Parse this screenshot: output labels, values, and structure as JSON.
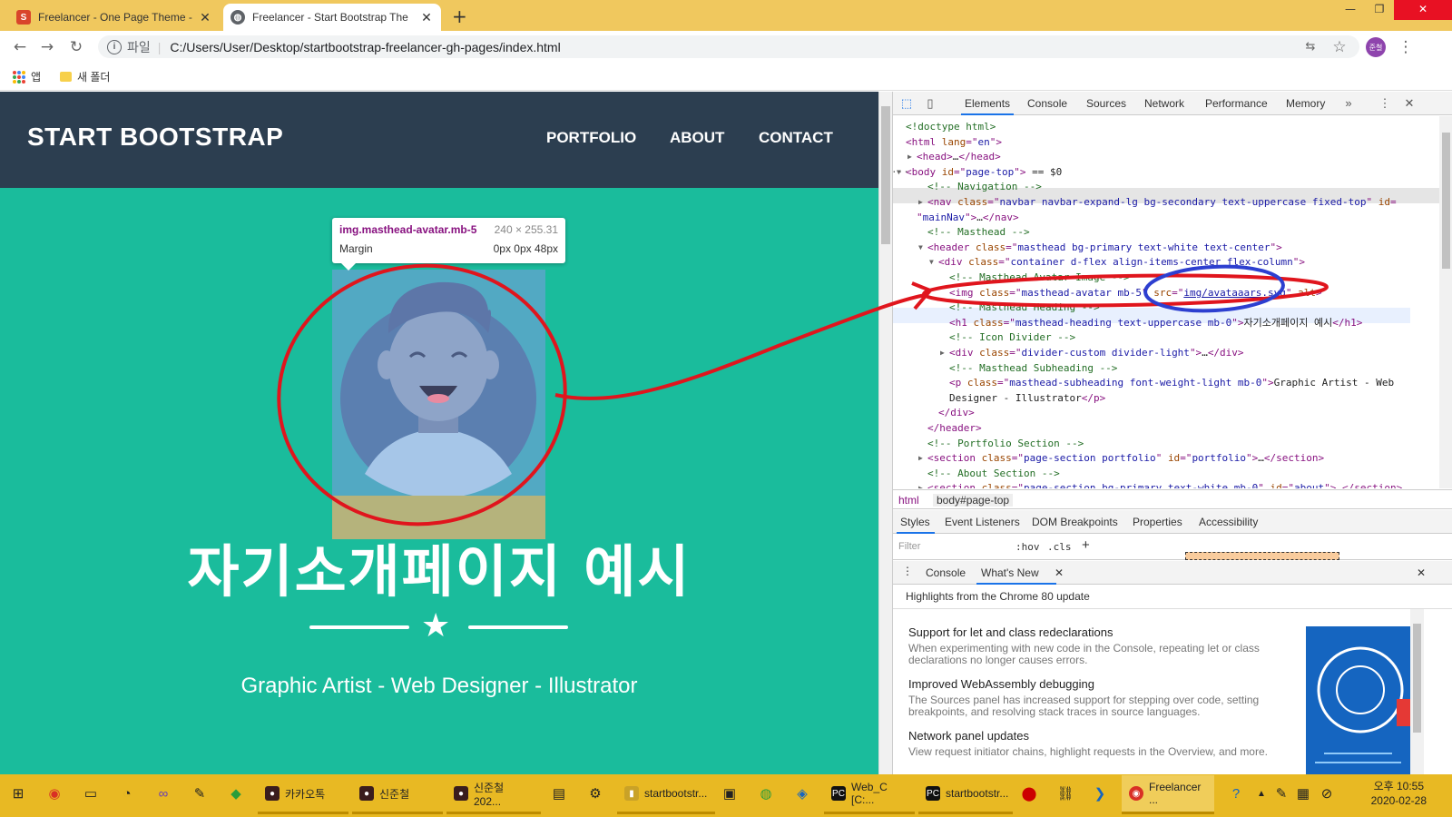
{
  "browser": {
    "tabs": [
      {
        "title": "Freelancer - One Page Theme -",
        "icon": "s-logo-icon"
      },
      {
        "title": "Freelancer - Start Bootstrap The",
        "icon": "globe-icon"
      }
    ],
    "address_label": "파일",
    "url": "C:/Users/User/Desktop/startbootstrap-freelancer-gh-pages/index.html",
    "profile_initials": "준철",
    "bookmarks": {
      "apps_label": "앱",
      "folder_label": "새 폴더"
    }
  },
  "page": {
    "brand": "START BOOTSTRAP",
    "nav": [
      "PORTFOLIO",
      "ABOUT",
      "CONTACT"
    ],
    "heading": "자기소개페이지 예시",
    "subheading": "Graphic Artist - Web Designer - Illustrator",
    "tooltip": {
      "selector": "img.masthead-avatar.mb-5",
      "size": "240 × 255.31",
      "margin_label": "Margin",
      "margin_value": "0px 0px 48px"
    }
  },
  "devtools": {
    "tabs": [
      "Elements",
      "Console",
      "Sources",
      "Network",
      "Performance",
      "Memory"
    ],
    "dom": [
      {
        "indent": 0,
        "parts": [
          [
            "cm",
            "<!doctype html>"
          ]
        ]
      },
      {
        "indent": 0,
        "parts": [
          [
            "tg",
            "<html "
          ],
          [
            "at",
            "lang"
          ],
          [
            "tg",
            "=\""
          ],
          [
            "av",
            "en"
          ],
          [
            "tg",
            "\">"
          ]
        ]
      },
      {
        "indent": 1,
        "arrow": "▶",
        "parts": [
          [
            "tg",
            "<head>"
          ],
          [
            "tx",
            "…"
          ],
          [
            "tg",
            "</head>"
          ]
        ]
      },
      {
        "indent": 0,
        "arrow": "▼",
        "prefix": "···",
        "parts": [
          [
            "tg",
            "<body "
          ],
          [
            "at",
            "id"
          ],
          [
            "tg",
            "=\""
          ],
          [
            "av",
            "page-top"
          ],
          [
            "tg",
            "\">"
          ],
          [
            "tx",
            " == $0"
          ]
        ]
      },
      {
        "indent": 2,
        "parts": [
          [
            "cm",
            "<!-- Navigation -->"
          ]
        ]
      },
      {
        "indent": 2,
        "arrow": "▶",
        "parts": [
          [
            "tg",
            "<nav "
          ],
          [
            "at",
            "class"
          ],
          [
            "tg",
            "=\""
          ],
          [
            "av",
            "navbar navbar-expand-lg bg-secondary text-uppercase fixed-top"
          ],
          [
            "tg",
            "\" "
          ],
          [
            "at",
            "id"
          ],
          [
            "tg",
            "="
          ]
        ]
      },
      {
        "indent": 1,
        "parts": [
          [
            "tg",
            "\""
          ],
          [
            "av",
            "mainNav"
          ],
          [
            "tg",
            "\">"
          ],
          [
            "tx",
            "…"
          ],
          [
            "tg",
            "</nav>"
          ]
        ]
      },
      {
        "indent": 2,
        "parts": [
          [
            "cm",
            "<!-- Masthead -->"
          ]
        ]
      },
      {
        "indent": 2,
        "arrow": "▼",
        "parts": [
          [
            "tg",
            "<header "
          ],
          [
            "at",
            "class"
          ],
          [
            "tg",
            "=\""
          ],
          [
            "av",
            "masthead bg-primary text-white text-center"
          ],
          [
            "tg",
            "\">"
          ]
        ]
      },
      {
        "indent": 3,
        "arrow": "▼",
        "parts": [
          [
            "tg",
            "<div "
          ],
          [
            "at",
            "class"
          ],
          [
            "tg",
            "=\""
          ],
          [
            "av",
            "container d-flex align-items-center flex-column"
          ],
          [
            "tg",
            "\">"
          ]
        ]
      },
      {
        "indent": 4,
        "parts": [
          [
            "cm",
            "<!-- Masthead Avatar Image -->"
          ]
        ]
      },
      {
        "indent": 4,
        "parts": [
          [
            "tg",
            "<img "
          ],
          [
            "at",
            "class"
          ],
          [
            "tg",
            "=\""
          ],
          [
            "av",
            "masthead-avatar mb-5"
          ],
          [
            "tg",
            "\" "
          ],
          [
            "at",
            "src"
          ],
          [
            "tg",
            "=\""
          ],
          [
            "lk",
            "img/avataaars.svg"
          ],
          [
            "tg",
            "\" "
          ],
          [
            "at",
            "alt"
          ],
          [
            "tg",
            ">"
          ]
        ]
      },
      {
        "indent": 4,
        "parts": [
          [
            "cm",
            "<!-- Masthead Heading -->"
          ]
        ]
      },
      {
        "indent": 4,
        "parts": [
          [
            "tg",
            "<h1 "
          ],
          [
            "at",
            "class"
          ],
          [
            "tg",
            "=\""
          ],
          [
            "av",
            "masthead-heading text-uppercase mb-0"
          ],
          [
            "tg",
            "\">"
          ],
          [
            "tx",
            "자기소개페이지 예시"
          ],
          [
            "tg",
            "</h1>"
          ]
        ]
      },
      {
        "indent": 4,
        "parts": [
          [
            "cm",
            "<!-- Icon Divider -->"
          ]
        ]
      },
      {
        "indent": 4,
        "arrow": "▶",
        "parts": [
          [
            "tg",
            "<div "
          ],
          [
            "at",
            "class"
          ],
          [
            "tg",
            "=\""
          ],
          [
            "av",
            "divider-custom divider-light"
          ],
          [
            "tg",
            "\">"
          ],
          [
            "tx",
            "…"
          ],
          [
            "tg",
            "</div>"
          ]
        ]
      },
      {
        "indent": 4,
        "parts": [
          [
            "cm",
            "<!-- Masthead Subheading -->"
          ]
        ]
      },
      {
        "indent": 4,
        "parts": [
          [
            "tg",
            "<p "
          ],
          [
            "at",
            "class"
          ],
          [
            "tg",
            "=\""
          ],
          [
            "av",
            "masthead-subheading font-weight-light mb-0"
          ],
          [
            "tg",
            "\">"
          ],
          [
            "tx",
            "Graphic Artist - Web"
          ]
        ]
      },
      {
        "indent": 4,
        "parts": [
          [
            "tx",
            "Designer - Illustrator"
          ],
          [
            "tg",
            "</p>"
          ]
        ]
      },
      {
        "indent": 3,
        "parts": [
          [
            "tg",
            "</div>"
          ]
        ]
      },
      {
        "indent": 2,
        "parts": [
          [
            "tg",
            "</header>"
          ]
        ]
      },
      {
        "indent": 2,
        "parts": [
          [
            "cm",
            "<!-- Portfolio Section -->"
          ]
        ]
      },
      {
        "indent": 2,
        "arrow": "▶",
        "parts": [
          [
            "tg",
            "<section "
          ],
          [
            "at",
            "class"
          ],
          [
            "tg",
            "=\""
          ],
          [
            "av",
            "page-section portfolio"
          ],
          [
            "tg",
            "\" "
          ],
          [
            "at",
            "id"
          ],
          [
            "tg",
            "=\""
          ],
          [
            "av",
            "portfolio"
          ],
          [
            "tg",
            "\">"
          ],
          [
            "tx",
            "…"
          ],
          [
            "tg",
            "</section>"
          ]
        ]
      },
      {
        "indent": 2,
        "parts": [
          [
            "cm",
            "<!-- About Section -->"
          ]
        ]
      },
      {
        "indent": 2,
        "arrow": "▶",
        "parts": [
          [
            "tg",
            "<section "
          ],
          [
            "at",
            "class"
          ],
          [
            "tg",
            "=\""
          ],
          [
            "av",
            "page-section bg-primary text-white mb-0"
          ],
          [
            "tg",
            "\" "
          ],
          [
            "at",
            "id"
          ],
          [
            "tg",
            "=\""
          ],
          [
            "av",
            "about"
          ],
          [
            "tg",
            "\">"
          ],
          [
            "tx",
            "…"
          ],
          [
            "tg",
            "</section>"
          ]
        ]
      }
    ],
    "breadcrumbs": [
      "html",
      "body#page-top"
    ],
    "style_tabs": [
      "Styles",
      "Event Listeners",
      "DOM Breakpoints",
      "Properties",
      "Accessibility"
    ],
    "filter_placeholder": "Filter",
    "hov": ":hov",
    "cls": ".cls",
    "drawer_tabs": [
      "Console",
      "What's New"
    ],
    "whatsnew_header": "Highlights from the Chrome 80 update",
    "whatsnew": [
      {
        "title": "Support for let and class redeclarations",
        "desc": "When experimenting with new code in the Console, repeating let or class declarations no longer causes errors."
      },
      {
        "title": "Improved WebAssembly debugging",
        "desc": "The Sources panel has increased support for stepping over code, setting breakpoints, and resolving stack traces in source languages."
      },
      {
        "title": "Network panel updates",
        "desc": "View request initiator chains, highlight requests in the Overview, and more."
      }
    ]
  },
  "taskbar": {
    "buttons": [
      "카카오톡",
      "신준철",
      "신준철 202...",
      "startbootstr...",
      "Web_C [C:...",
      "startbootstr...",
      "Freelancer ..."
    ],
    "time": "오후 10:55",
    "date": "2020-02-28"
  },
  "colors": {
    "teal": "#1abc9c",
    "navy": "#2c3e50",
    "annotation_red": "#e0151d",
    "annotation_blue": "#2d3fd0"
  }
}
